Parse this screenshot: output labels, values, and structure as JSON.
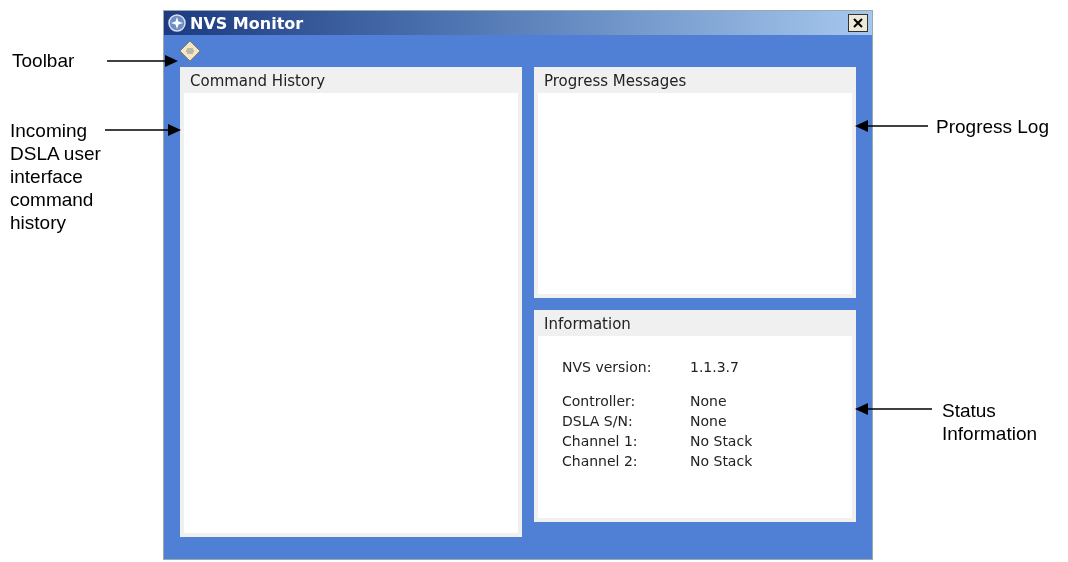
{
  "window": {
    "title": "NVS Monitor"
  },
  "panels": {
    "command_history": {
      "title": "Command History"
    },
    "progress_messages": {
      "title": "Progress Messages"
    },
    "information": {
      "title": "Information",
      "groups": [
        [
          {
            "label": "NVS version:",
            "value": "1.1.3.7"
          }
        ],
        [
          {
            "label": "Controller:",
            "value": "None"
          },
          {
            "label": "DSLA S/N:",
            "value": "None"
          },
          {
            "label": "Channel 1:",
            "value": "No Stack"
          },
          {
            "label": "Channel 2:",
            "value": "No Stack"
          }
        ]
      ]
    }
  },
  "callouts": [
    {
      "text": "Toolbar"
    },
    {
      "text": "Incoming DSLA user interface command history"
    },
    {
      "text": "Progress Log"
    },
    {
      "text": "Status Information"
    }
  ]
}
